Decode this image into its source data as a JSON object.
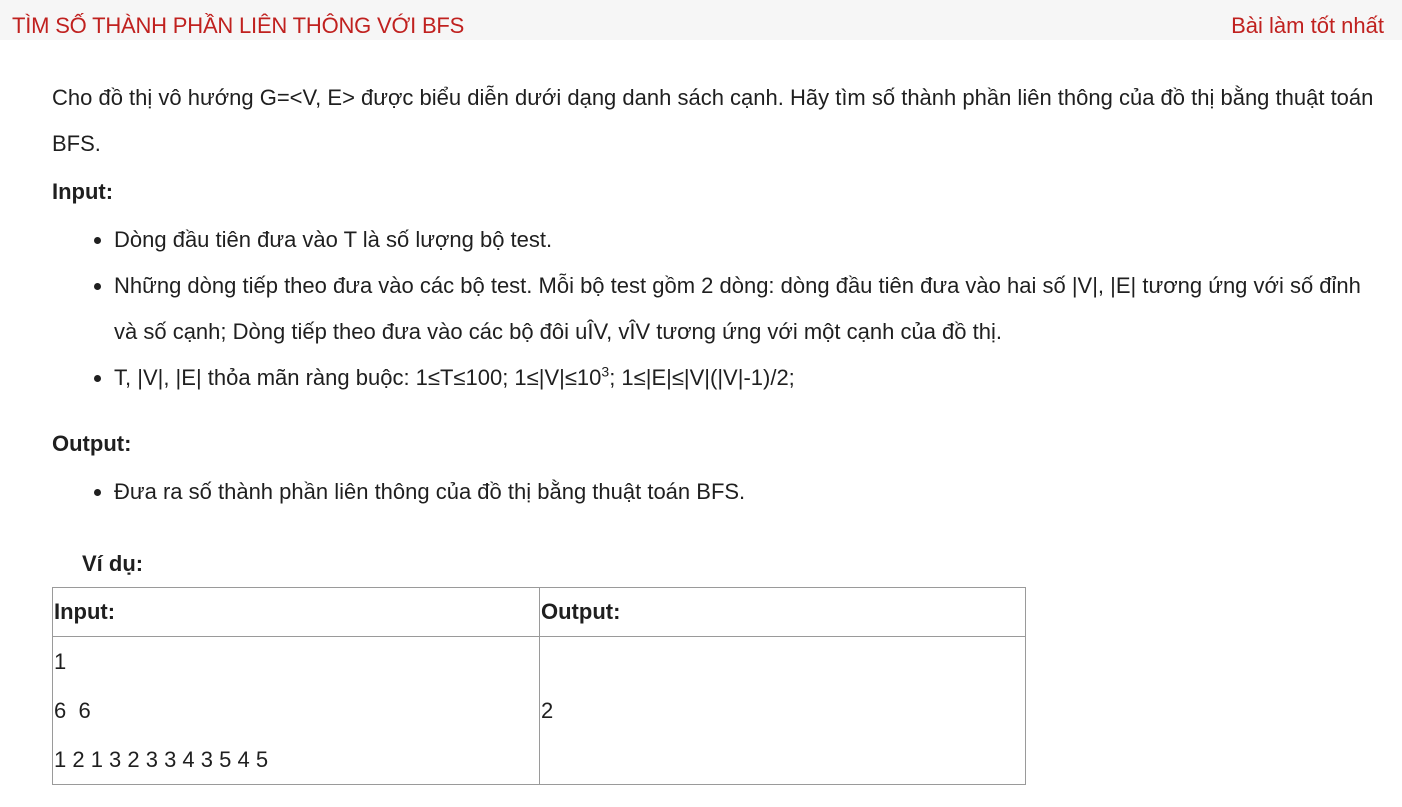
{
  "header": {
    "title": "TÌM SỐ THÀNH PHẦN LIÊN THÔNG VỚI BFS",
    "best_link": "Bài làm tốt nhất"
  },
  "problem": {
    "intro": "Cho đồ thị vô hướng G=<V, E> được biểu diễn dưới dạng danh sách cạnh. Hãy tìm số thành phần liên thông của đồ thị bằng thuật toán BFS.",
    "input_heading": "Input:",
    "input_items": [
      "Dòng đầu tiên đưa vào T là số lượng bộ test.",
      "Những dòng tiếp theo đưa vào các bộ test. Mỗi bộ test gồm 2 dòng: dòng đầu tiên đưa vào hai số |V|, |E| tương ứng với số đỉnh và số cạnh; Dòng tiếp theo đưa vào các bộ đôi uÎV, vÎV tương ứng với một cạnh của đồ thị."
    ],
    "constraint_prefix": "T, |V|, |E| thỏa mãn ràng buộc: 1≤T≤100; 1≤|V|≤10",
    "constraint_exp": "3",
    "constraint_suffix": "; 1≤|E|≤|V|(|V|-1)/2;",
    "output_heading": "Output:",
    "output_items": [
      "Đưa ra số thành phần liên thông của đồ thị bằng thuật toán BFS."
    ]
  },
  "example": {
    "label": "Ví dụ:",
    "input_header": "Input:",
    "output_header": "Output:",
    "input_lines": [
      "1",
      "6  6",
      "1 2 1 3 2 3 3 4 3 5 4 5"
    ],
    "output_value": "2"
  }
}
